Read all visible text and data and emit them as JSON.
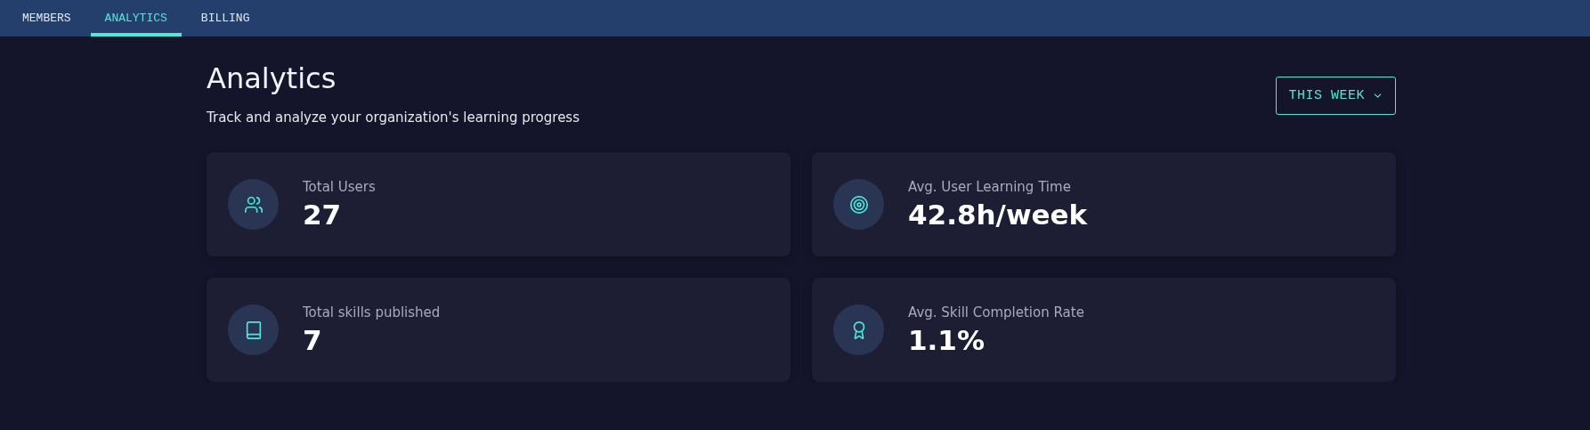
{
  "tabs": [
    {
      "label": "MEMBERS",
      "selected": false
    },
    {
      "label": "ANALYTICS",
      "selected": true
    },
    {
      "label": "BILLING",
      "selected": false
    }
  ],
  "header": {
    "title": "Analytics",
    "subtitle": "Track and analyze your organization's learning progress"
  },
  "period_dropdown": {
    "label": "THIS WEEK"
  },
  "stats": [
    {
      "kind": "users",
      "label": "Total Users",
      "value": "27"
    },
    {
      "kind": "target",
      "label": "Avg. User Learning Time",
      "value": "42.8h/week"
    },
    {
      "kind": "book",
      "label": "Total skills published",
      "value": "7"
    },
    {
      "kind": "award",
      "label": "Avg. Skill Completion Rate",
      "value": "1.1%"
    }
  ]
}
